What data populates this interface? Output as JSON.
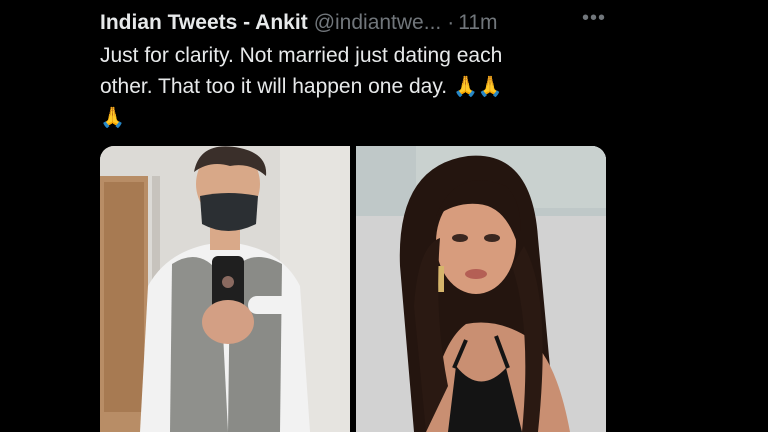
{
  "tweet": {
    "display_name": "Indian Tweets - Ankit",
    "handle": "@indiantwe...",
    "separator": "·",
    "time": "11m",
    "more_icon": "more-icon",
    "text_line1": "Just for clarity. Not married just dating each",
    "text_line2": "other. That too it will happen one day.",
    "emoji_inline": "🙏🙏",
    "emoji_line3": "🙏"
  },
  "media": {
    "left_photo_icon": "photo-man-mirror-selfie",
    "right_photo_icon": "photo-woman-portrait"
  },
  "colors": {
    "background": "#000000",
    "text_primary": "#e7e9ea",
    "text_secondary": "#71767b"
  }
}
